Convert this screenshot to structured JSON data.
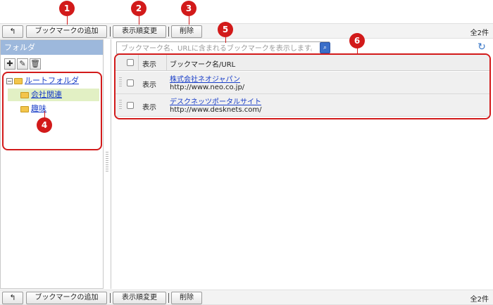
{
  "markers": [
    "1",
    "2",
    "3",
    "4",
    "5",
    "6"
  ],
  "toolbar": {
    "back_icon": "arrow-return-icon",
    "back_glyph": "↰",
    "add_label": "ブックマークの追加",
    "sort_label": "表示順変更",
    "delete_label": "削除",
    "count": "全2件"
  },
  "sidebar": {
    "header": "フォルダ",
    "tools": [
      {
        "icon": "plus-icon",
        "glyph": "✚"
      },
      {
        "icon": "pencil-icon",
        "glyph": "✎"
      },
      {
        "icon": "trash-icon",
        "glyph": "🗑"
      }
    ],
    "tree": {
      "expander": "−",
      "root": "ルートフォルダ",
      "children": [
        "会社関連",
        "趣味"
      ]
    }
  },
  "search": {
    "placeholder": "ブックマーク名、URLに含まれるブックマークを表示します。",
    "value": "",
    "icon": "search-icon",
    "glyph": "⌕"
  },
  "refresh": {
    "icon": "refresh-icon",
    "glyph": "↻"
  },
  "table": {
    "headers": {
      "display": "表示",
      "name": "ブックマーク名/URL"
    },
    "rows": [
      {
        "display": "表示",
        "name": "株式会社ネオジャパン",
        "url": "http://www.neo.co.jp/"
      },
      {
        "display": "表示",
        "name": "デスクネッツポータルサイト",
        "url": "http://www.desknets.com/"
      }
    ]
  },
  "colors": {
    "marker": "#d21a1a",
    "header_bg": "#9db8dc",
    "link": "#1a3fc8",
    "selected": "#e2f0c4"
  }
}
